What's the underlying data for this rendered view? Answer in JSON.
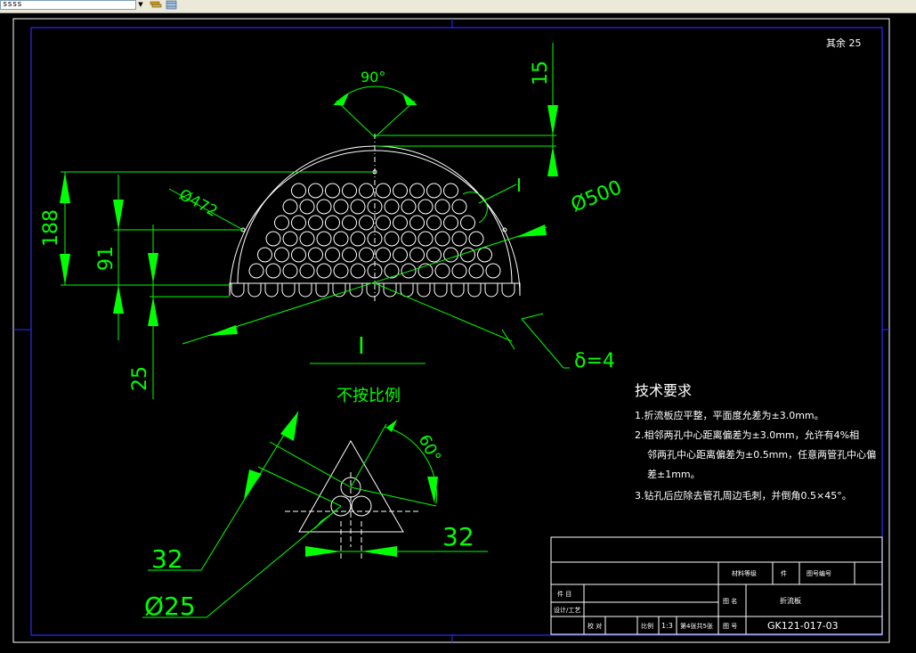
{
  "toolbar": {
    "layer_value": "ssss",
    "icons": [
      "layer-states-icon",
      "layer-previous-icon"
    ]
  },
  "drawing": {
    "roughness": "其余 25",
    "dims": {
      "angle_top": "90°",
      "d15": "15",
      "d188": "188",
      "d91": "91",
      "d25": "25",
      "phi472": "Ø472",
      "phi500": "Ø500",
      "delta": "δ=4",
      "angle_60": "60°",
      "d32_left": "32",
      "d32_right": "32",
      "phi25": "Ø25"
    },
    "detail_marker_top": "I",
    "detail_label": "I",
    "detail_note": "不按比例",
    "tech": {
      "heading": "技术要求",
      "lines": [
        "1.折流板应平整，平面度允差为±3.0mm。",
        "2.相邻两孔中心距离偏差为±3.0mm，允许有4%相",
        "邻两孔中心距离偏差为±0.5mm，任意两管孔中心偏",
        "差±1mm。",
        "3.钻孔后应除去管孔周边毛刺，并倒角0.5×45°。"
      ]
    },
    "title_block": {
      "material_label": "材料等级",
      "unit": "件",
      "part_no_label": "图号编号",
      "item_label": "件 目",
      "design_label": "设计/工艺",
      "drawing_name_label": "图 名",
      "drawing_name": "折流板",
      "check_label": "校 对",
      "scale_label": "比例",
      "scale": "1:3",
      "sheet": "第4张共5张",
      "drawing_no_label": "图 号",
      "drawing_no": "GK121-017-03"
    }
  }
}
